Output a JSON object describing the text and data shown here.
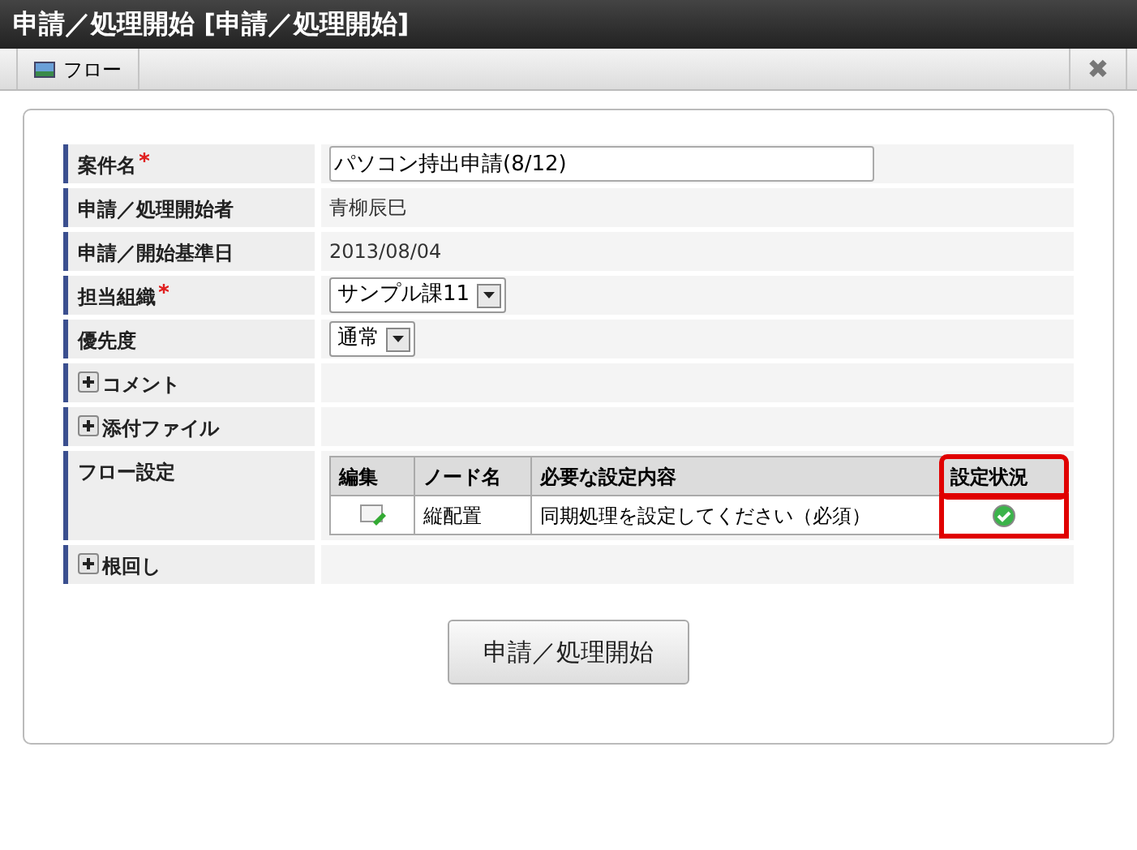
{
  "window": {
    "title": "申請／処理開始 [申請／処理開始]"
  },
  "toolbar": {
    "tab": "フロー",
    "close": "✖"
  },
  "form": [
    {
      "kind": "input",
      "label": "案件名",
      "required": true,
      "value": "パソコン持出申請(8/12)"
    },
    {
      "kind": "text",
      "label": "申請／処理開始者",
      "required": false,
      "value": "青柳辰巳"
    },
    {
      "kind": "date",
      "label": "申請／開始基準日",
      "required": false,
      "value": "2013/08/04"
    },
    {
      "kind": "select",
      "label": "担当組織",
      "required": true,
      "value": "サンプル課11"
    },
    {
      "kind": "select",
      "label": "優先度",
      "required": false,
      "value": "通常"
    },
    {
      "kind": "expander",
      "label": "コメント",
      "required": false,
      "expanded": false
    },
    {
      "kind": "expander",
      "label": "添付ファイル",
      "required": false,
      "expanded": false
    },
    {
      "kind": "flow",
      "label": "フロー設定",
      "required": false,
      "table": {
        "columns": [
          "編集",
          "ノード名",
          "必要な設定内容",
          "設定状況"
        ],
        "rows": [
          {
            "node": "縦配置",
            "content": "同期処理を設定してください（必須）",
            "done": true
          }
        ]
      }
    },
    {
      "kind": "expander",
      "label": "根回し",
      "required": false,
      "expanded": false
    }
  ],
  "submit": "申請／処理開始"
}
